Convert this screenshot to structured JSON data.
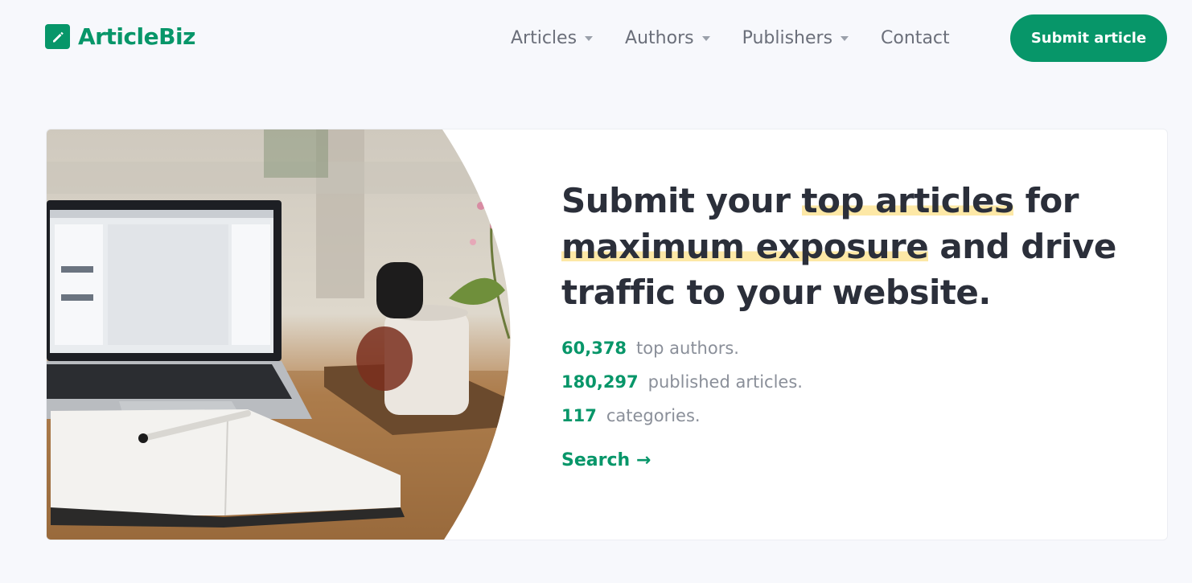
{
  "brand": {
    "name": "ArticleBiz",
    "color": "#079669"
  },
  "nav": {
    "items": [
      {
        "label": "Articles",
        "has_dropdown": true
      },
      {
        "label": "Authors",
        "has_dropdown": true
      },
      {
        "label": "Publishers",
        "has_dropdown": true
      },
      {
        "label": "Contact",
        "has_dropdown": false
      }
    ],
    "cta_label": "Submit article"
  },
  "hero": {
    "headline_parts": [
      "Submit your ",
      "top articles",
      " for ",
      "maximum exposure",
      " and drive traffic to your website."
    ],
    "highlight_color": "#fde8a6",
    "stats": [
      {
        "value": "60,378",
        "label": "top authors."
      },
      {
        "value": "180,297",
        "label": "published articles."
      },
      {
        "value": "117",
        "label": "categories."
      }
    ],
    "search_link": "Search →",
    "image_icon": "laptop-notebook-coffee-photo"
  }
}
